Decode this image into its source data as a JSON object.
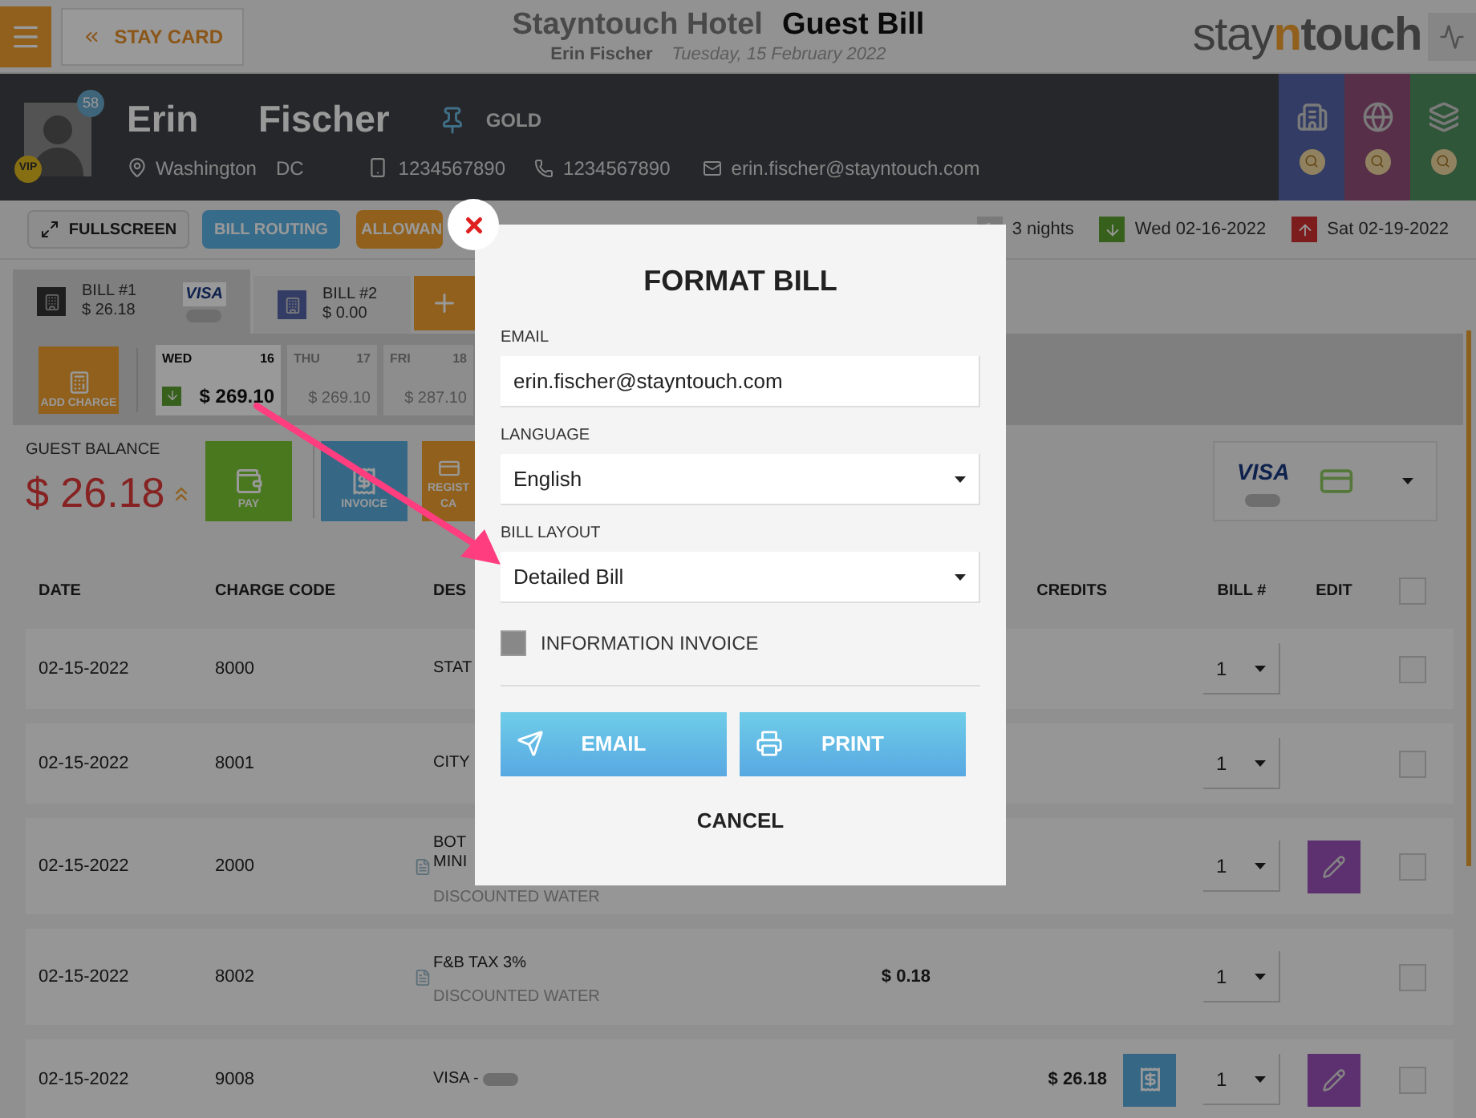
{
  "header": {
    "back_button": "STAY CARD",
    "hotel": "Stayntouch Hotel",
    "title": "Guest Bill",
    "guest_name": "Erin Fischer",
    "date": "Tuesday, 15 February 2022",
    "logo": {
      "prefix": "stay",
      "highlight": "n",
      "suffix": "touch"
    }
  },
  "guest": {
    "first_name": "Erin",
    "last_name": "Fischer",
    "loyalty_count": "58",
    "vip": "VIP",
    "membership": "GOLD",
    "city": "Washington",
    "state": "DC",
    "phone": "1234567890",
    "mobile": "1234567890",
    "email": "erin.fischer@stayntouch.com"
  },
  "toolbar": {
    "buttons": [
      {
        "label": "FULLSCREEN",
        "kind": "fullscreen"
      },
      {
        "label": "BILL ROUTING",
        "kind": "blue"
      },
      {
        "label": "ALLOWAN",
        "kind": "orange"
      }
    ],
    "nights": "3 nights",
    "arrival": "Wed 02-16-2022",
    "departure": "Sat 02-19-2022"
  },
  "bills": [
    {
      "label": "BILL #1",
      "amount": "$ 26.18",
      "selected": true,
      "card": "VISA"
    },
    {
      "label": "BILL #2",
      "amount": "$ 0.00",
      "selected": false
    }
  ],
  "add_charge": "ADD CHARGE",
  "days": [
    {
      "day": "WED",
      "date": "16",
      "amount": "$ 269.10",
      "selected": true,
      "arrival": true
    },
    {
      "day": "THU",
      "date": "17",
      "amount": "$ 269.10",
      "selected": false,
      "arrival": false
    },
    {
      "day": "FRI",
      "date": "18",
      "amount": "$ 287.10",
      "selected": false,
      "arrival": false
    }
  ],
  "balance": {
    "label": "GUEST BALANCE",
    "amount": "$ 26.18"
  },
  "actions": [
    {
      "lines": [
        "PAY"
      ],
      "kind": "pay"
    },
    {
      "lines": [
        "INVOICE"
      ],
      "kind": "invoice"
    },
    {
      "lines": [
        "REGIST",
        "CA"
      ],
      "kind": "register"
    }
  ],
  "payment_card": {
    "brand": "VISA"
  },
  "table": {
    "columns": [
      "DATE",
      "CHARGE CODE",
      "DES",
      "CREDITS",
      "BILL #",
      "EDIT"
    ],
    "select_all": {
      "checked": false
    },
    "rows": [
      {
        "date": "02-15-2022",
        "code": "8000",
        "description": [
          "STAT"
        ],
        "bill": "1",
        "editable": false,
        "document": false,
        "receipt": false,
        "checked": false
      },
      {
        "date": "02-15-2022",
        "code": "8001",
        "description": [
          "CITY"
        ],
        "bill": "1",
        "editable": false,
        "document": false,
        "receipt": false,
        "checked": false
      },
      {
        "date": "02-15-2022",
        "code": "2000",
        "description": [
          "BOT",
          "MINI"
        ],
        "note": "DISCOUNTED WATER",
        "bill": "1",
        "editable": true,
        "document": true,
        "receipt": false,
        "checked": false
      },
      {
        "date": "02-15-2022",
        "code": "8002",
        "description": [
          "F&B TAX 3%"
        ],
        "note": "DISCOUNTED WATER",
        "debit": "$ 0.18",
        "bill": "1",
        "editable": false,
        "document": true,
        "receipt": false,
        "checked": false
      },
      {
        "date": "02-15-2022",
        "code": "9008",
        "description": [
          "VISA -"
        ],
        "masked": true,
        "credit": "$ 26.18",
        "bill": "1",
        "editable": true,
        "document": false,
        "receipt": true,
        "checked": false
      }
    ]
  },
  "modal": {
    "title": "FORMAT BILL",
    "fields": [
      {
        "label": "EMAIL",
        "kind": "text",
        "value": "erin.fischer@stayntouch.com"
      },
      {
        "label": "LANGUAGE",
        "kind": "select",
        "value": "English"
      },
      {
        "label": "BILL LAYOUT",
        "kind": "select",
        "value": "Detailed Bill"
      }
    ],
    "information_invoice": {
      "label": "INFORMATION INVOICE",
      "checked": false
    },
    "buttons": [
      {
        "label": "EMAIL",
        "kind": "email"
      },
      {
        "label": "PRINT",
        "kind": "print"
      }
    ],
    "cancel": "CANCEL"
  }
}
